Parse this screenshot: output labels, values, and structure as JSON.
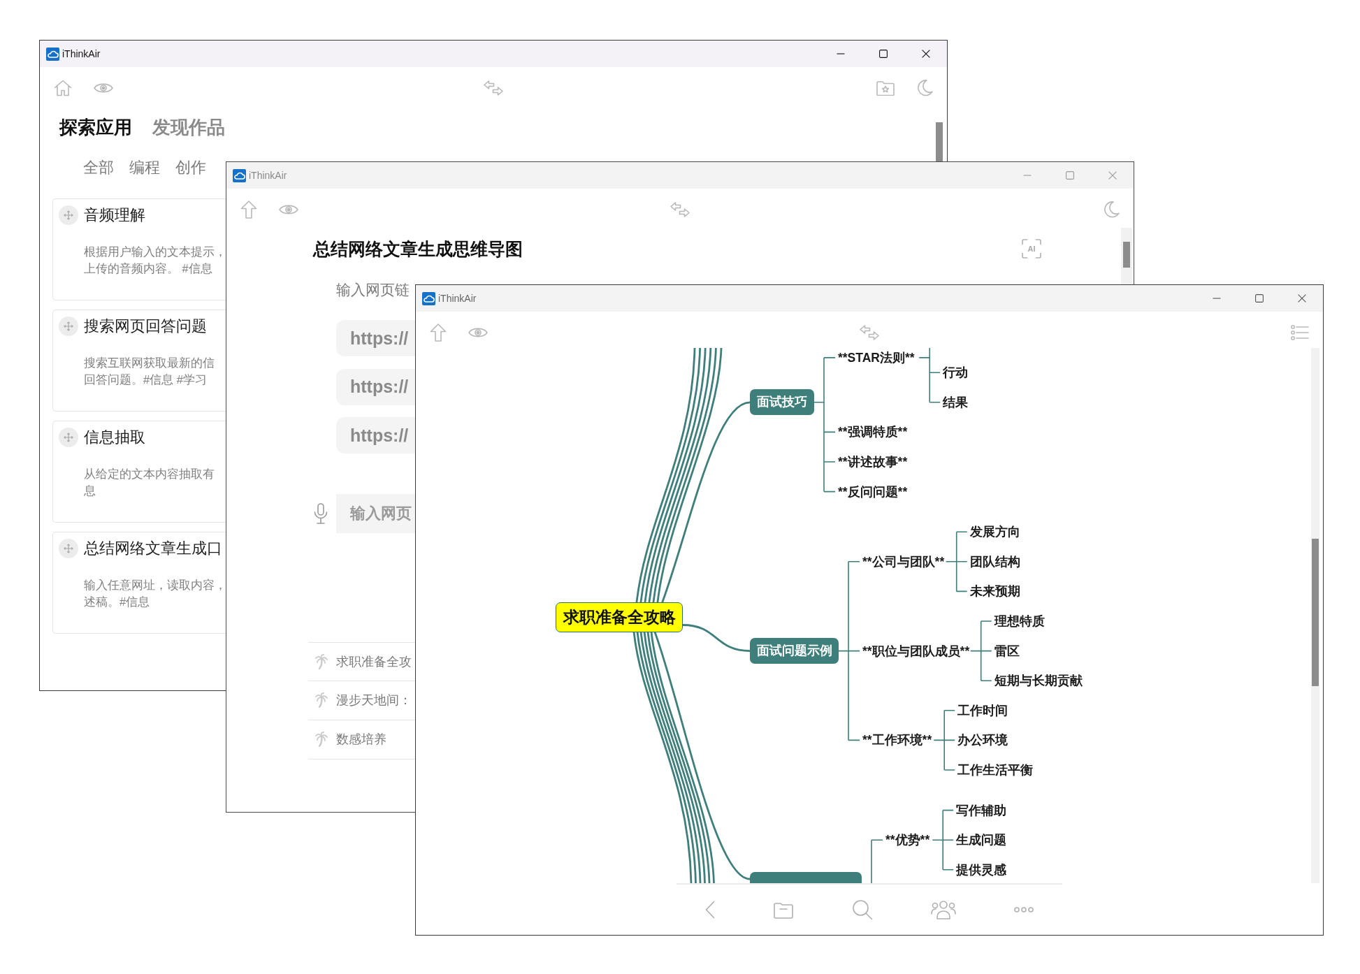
{
  "windows": [
    {
      "kind": "explore",
      "title": "iThinkAir",
      "heading_tabs": [
        {
          "label": "探索应用",
          "selected": true
        },
        {
          "label": "发现作品",
          "selected": false
        }
      ],
      "filter_tabs": [
        "全部",
        "编程",
        "创作"
      ],
      "cards": [
        {
          "title": "音频理解",
          "description": [
            "根据用户输入的文本提示，",
            "上传的音频内容。 #信息"
          ]
        },
        {
          "title": "搜索网页回答问题",
          "description": [
            "搜索互联网获取最新的信",
            "回答问题。#信息 #学习"
          ]
        },
        {
          "title": "信息抽取",
          "description": [
            "从给定的文本内容抽取有",
            "息"
          ]
        },
        {
          "title": "总结网络文章生成口",
          "description": [
            "输入任意网址，读取内容，",
            "述稿。#信息"
          ]
        }
      ]
    },
    {
      "kind": "prompt",
      "title": "iThinkAir",
      "heading": "总结网络文章生成思维导图",
      "ai_button": "AI",
      "description": "输入网页链",
      "examples": [
        "https://",
        "https://",
        "https://"
      ],
      "input": {
        "placeholder": "输入网页"
      },
      "history": [
        "求职准备全攻",
        "漫步天地间：",
        "数感培养"
      ]
    },
    {
      "kind": "mindmap",
      "title": "iThinkAir",
      "mindmap": {
        "root": "求职准备全攻略",
        "branches": [
          {
            "label": "面试技巧",
            "children": [
              {
                "label": "**STAR法则**",
                "children": [
                  {
                    "label": "行动"
                  },
                  {
                    "label": "结果"
                  }
                ]
              },
              {
                "label": "**强调特质**"
              },
              {
                "label": "**讲述故事**"
              },
              {
                "label": "**反问问题**"
              }
            ]
          },
          {
            "label": "面试问题示例",
            "children": [
              {
                "label": "**公司与团队**",
                "children": [
                  {
                    "label": "发展方向"
                  },
                  {
                    "label": "团队结构"
                  },
                  {
                    "label": "未来预期"
                  }
                ]
              },
              {
                "label": "**职位与团队成员**",
                "children": [
                  {
                    "label": "理想特质"
                  },
                  {
                    "label": "雷区"
                  },
                  {
                    "label": "短期与长期贡献"
                  }
                ]
              },
              {
                "label": "**工作环境**",
                "children": [
                  {
                    "label": "工作时间"
                  },
                  {
                    "label": "办公环境"
                  },
                  {
                    "label": "工作生活平衡"
                  }
                ]
              }
            ]
          },
          {
            "children": [
              {
                "label": "**优势**",
                "children": [
                  {
                    "label": "写作辅助"
                  },
                  {
                    "label": "生成问题"
                  },
                  {
                    "label": "提供灵感"
                  }
                ]
              }
            ]
          }
        ]
      }
    }
  ]
}
